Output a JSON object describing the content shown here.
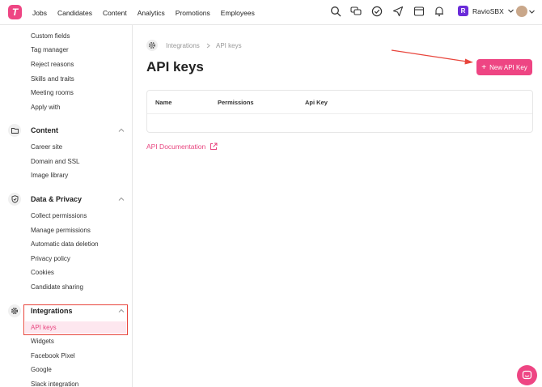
{
  "topbar": {
    "logo_letter": "T",
    "nav": [
      "Jobs",
      "Candidates",
      "Content",
      "Analytics",
      "Promotions",
      "Employees"
    ],
    "org_badge": "R",
    "org_name": "RavioSBX"
  },
  "sidebar": {
    "top_items": [
      "Custom fields",
      "Tag manager",
      "Reject reasons",
      "Skills and traits",
      "Meeting rooms",
      "Apply with"
    ],
    "content": {
      "label": "Content",
      "items": [
        "Career site",
        "Domain and SSL",
        "Image library"
      ]
    },
    "privacy": {
      "label": "Data & Privacy",
      "items": [
        "Collect permissions",
        "Manage permissions",
        "Automatic data deletion",
        "Privacy policy",
        "Cookies",
        "Candidate sharing"
      ]
    },
    "integrations": {
      "label": "Integrations",
      "items": [
        "API keys",
        "Widgets",
        "Facebook Pixel",
        "Google",
        "Slack integration"
      ]
    }
  },
  "main": {
    "breadcrumb": [
      "Integrations",
      "API keys"
    ],
    "title": "API keys",
    "add_button": "New API Key",
    "table_headers": [
      "Name",
      "Permissions",
      "Api Key"
    ],
    "doc_link": "API Documentation"
  },
  "colors": {
    "accent": "#ee4583",
    "annotation": "#e8453c"
  }
}
